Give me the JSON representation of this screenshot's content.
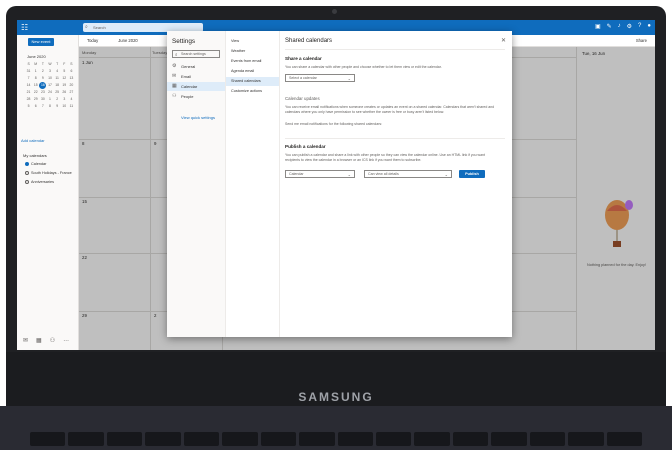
{
  "device": {
    "brand": "SAMSUNG"
  },
  "topbar": {
    "search_placeholder": "Search",
    "icons": [
      "teams-icon",
      "notes-icon",
      "bell-icon",
      "gear-icon",
      "help-icon",
      "avatar"
    ]
  },
  "left": {
    "new_event": "New event",
    "mini_month": "June 2020",
    "weekdays": [
      "S",
      "M",
      "T",
      "W",
      "T",
      "F",
      "S"
    ],
    "weeks": [
      [
        "31",
        "1",
        "2",
        "3",
        "4",
        "5",
        "6"
      ],
      [
        "7",
        "8",
        "9",
        "10",
        "11",
        "12",
        "13"
      ],
      [
        "14",
        "15",
        "16",
        "17",
        "18",
        "19",
        "20"
      ],
      [
        "21",
        "22",
        "23",
        "24",
        "25",
        "26",
        "27"
      ],
      [
        "28",
        "29",
        "30",
        "1",
        "2",
        "3",
        "4"
      ],
      [
        "5",
        "6",
        "7",
        "8",
        "9",
        "10",
        "11"
      ]
    ],
    "selected_day": "16",
    "add_calendar": "Add calendar",
    "my_calendars": "My calendars",
    "calendars": [
      {
        "label": "Calendar",
        "checked": true
      },
      {
        "label": "South Holidays - France",
        "checked": false
      },
      {
        "label": "Anniversaries",
        "checked": false
      }
    ]
  },
  "cmdbar": {
    "today": "Today",
    "month": "June 2020",
    "share": "Share"
  },
  "grid": {
    "day_headers": [
      "Monday",
      "Tuesday"
    ],
    "day_numbers": [
      "1 Jun",
      "8",
      "15",
      "22",
      "29",
      "9",
      "2"
    ]
  },
  "rightpane": {
    "date": "Tue, 16 Jun",
    "empty_text": "Nothing planned for the day. Enjoy!"
  },
  "settings": {
    "title": "Settings",
    "search_placeholder": "Search settings",
    "nav": [
      {
        "label": "General",
        "icon": "gear-icon"
      },
      {
        "label": "Email",
        "icon": "mail-icon"
      },
      {
        "label": "Calendar",
        "icon": "calendar-icon",
        "selected": true
      },
      {
        "label": "People",
        "icon": "people-icon"
      }
    ],
    "quick_settings": "View quick settings",
    "subnav": [
      {
        "label": "View"
      },
      {
        "label": "Weather"
      },
      {
        "label": "Events from email"
      },
      {
        "label": "Agenda email"
      },
      {
        "label": "Shared calendars",
        "selected": true
      },
      {
        "label": "Customize actions"
      }
    ]
  },
  "shared": {
    "title": "Shared calendars",
    "share_heading": "Share a calendar",
    "share_desc": "You can share a calendar with other people and choose whether to let them view or edit the calendar.",
    "share_select": "Select a calendar",
    "updates_heading": "Calendar updates",
    "updates_desc": "You can receive email notifications when someone creates or updates an event on a shared calendar. Calendars that aren't shared and calendars where you only have permission to see whether the owner is free or busy aren't listed below.",
    "updates_line": "Send me email notifications for the following shared calendars:",
    "publish_heading": "Publish a calendar",
    "publish_desc": "You can publish a calendar and share a link with other people so they can view the calendar online. Use an HTML link if you want recipients to view the calendar in a browser or an ICS link if you want them to subscribe.",
    "publish_calendar": "Calendar",
    "publish_detail": "Can view all details",
    "publish_button": "Publish"
  }
}
